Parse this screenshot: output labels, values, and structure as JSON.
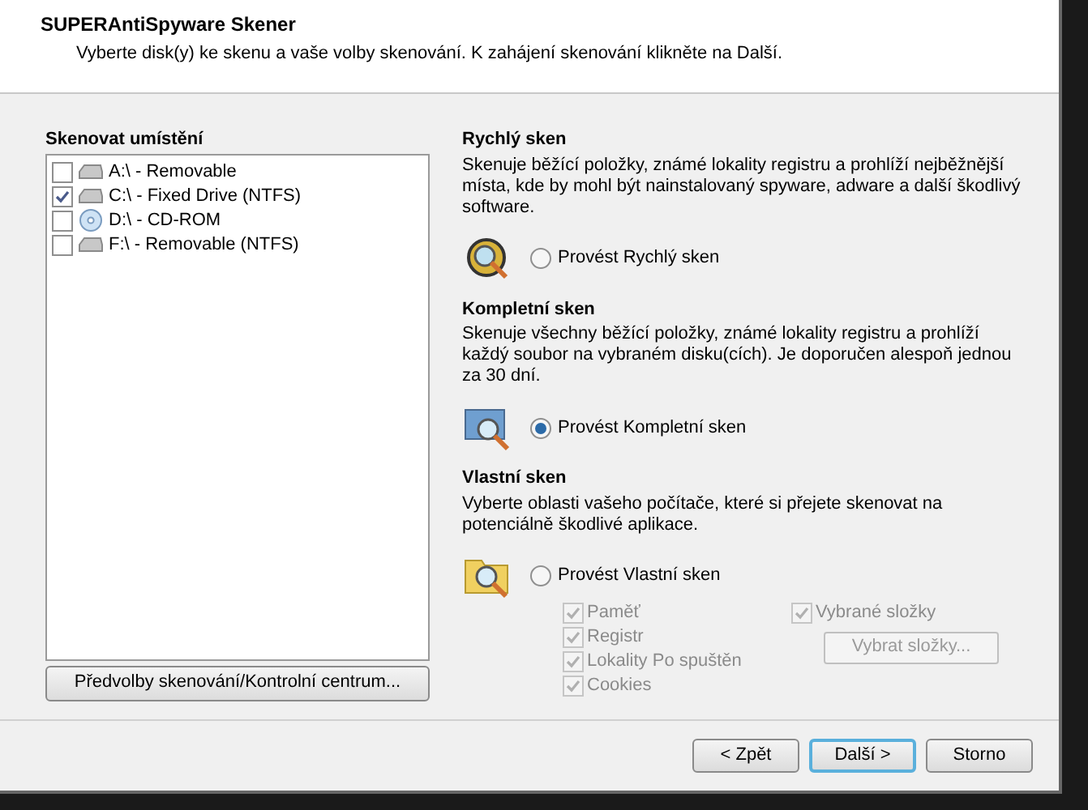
{
  "header": {
    "title": "SUPERAntiSpyware Skener",
    "subtitle": "Vyberte disk(y) ke skenu a vaše volby skenování. K zahájení skenování klikněte na Další."
  },
  "locations": {
    "label": "Skenovat umístění",
    "drives": [
      {
        "label": "A:\\ - Removable",
        "kind": "disk",
        "checked": false
      },
      {
        "label": "C:\\ - Fixed Drive (NTFS)",
        "kind": "disk",
        "checked": true
      },
      {
        "label": "D:\\ - CD-ROM",
        "kind": "cd",
        "checked": false
      },
      {
        "label": "F:\\ - Removable (NTFS)",
        "kind": "disk",
        "checked": false
      }
    ],
    "button": "Předvolby skenování/Kontrolní centrum..."
  },
  "scan_types": [
    {
      "kind": "quick",
      "title": "Rychlý sken",
      "description": "Skenuje běžící položky, známé lokality registru a prohlíží nejběžnější místa, kde by mohl být nainstalovaný spyware, adware a další škodlivý software.",
      "option": "Provést Rychlý sken",
      "selected": false
    },
    {
      "kind": "full",
      "title": "Kompletní sken",
      "description": "Skenuje všechny běžící položky, známé lokality registru a prohlíží každý soubor na vybraném disku(cích). Je doporučen alespoň jednou za 30 dní.",
      "option": "Provést Kompletní sken",
      "selected": true
    },
    {
      "kind": "custom",
      "title": "Vlastní sken",
      "description": "Vyberte oblasti vašeho počítače, které si přejete skenovat na potenciálně škodlivé aplikace.",
      "option": "Provést Vlastní sken",
      "selected": false
    }
  ],
  "custom_options": {
    "items": [
      {
        "label": "Paměť",
        "checked": true,
        "disabled": true
      },
      {
        "label": "Registr",
        "checked": true,
        "disabled": true
      },
      {
        "label": "Lokality Po spuštěn",
        "checked": true,
        "disabled": true
      },
      {
        "label": "Cookies",
        "checked": true,
        "disabled": true
      }
    ],
    "folders": {
      "label": "Vybrané složky",
      "checked": true,
      "disabled": true
    },
    "folders_button": {
      "label": "Vybrat složky...",
      "disabled": true
    }
  },
  "buttons": [
    {
      "label": "< Zpět",
      "selected": false
    },
    {
      "label": "Další >",
      "selected": true
    },
    {
      "label": "Storno",
      "selected": false
    }
  ]
}
